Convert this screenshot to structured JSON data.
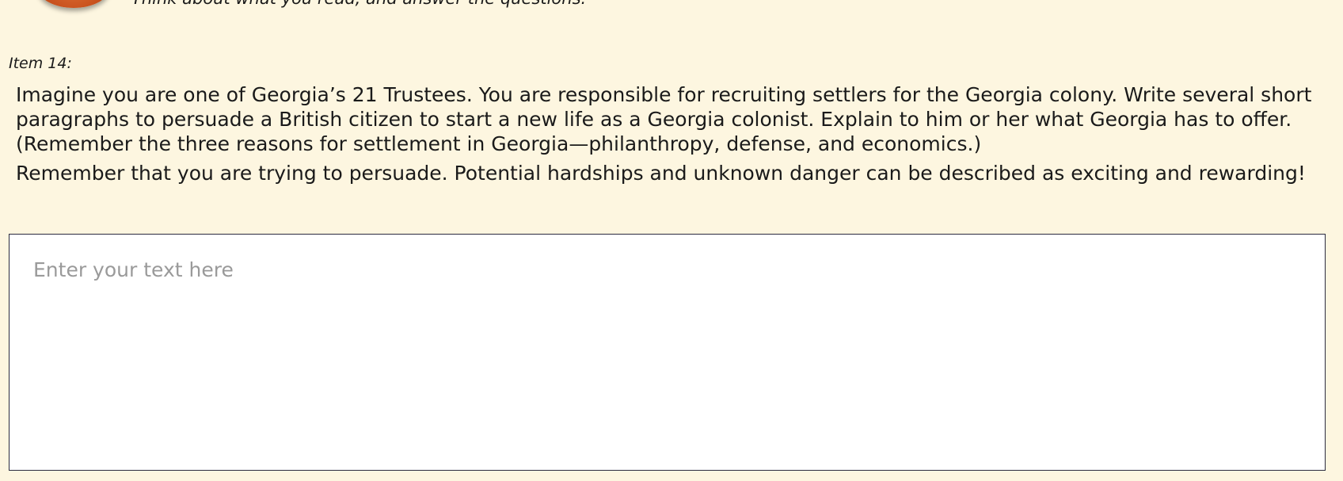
{
  "header": {
    "instruction": "Think about what you read, and answer the questions."
  },
  "item": {
    "label": "Item 14:",
    "prompt_paragraphs": [
      "Imagine you are one of Georgia’s 21 Trustees. You are responsible for recruiting settlers for the Georgia colony. Write several short paragraphs to persuade a British citizen to start a new life as a Georgia colonist. Explain to him or her what Georgia has to offer. (Remember the three reasons for settlement in Georgia—philanthropy, defense, and economics.)",
      "Remember that you are trying to persuade. Potential hardships and unknown danger can be described as exciting and rewarding!"
    ]
  },
  "answer": {
    "value": "",
    "placeholder": "Enter your text here"
  }
}
